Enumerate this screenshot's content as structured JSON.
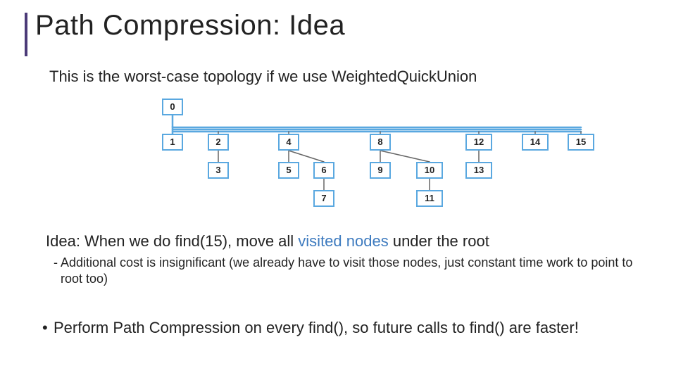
{
  "slide": {
    "title": "Path Compression: Idea",
    "subtitle": "This is the worst-case topology if we use WeightedQuickUnion",
    "idea_prefix": "Idea: When we do find(15), move all ",
    "idea_hl": "visited nodes",
    "idea_suffix": " under the root",
    "note": "- Additional cost is insignificant (we already have to visit those nodes, just constant time work to point to root too)",
    "bullet": "Perform Path Compression on every find(), so future calls to find() are faster!"
  },
  "tree": {
    "nodes": {
      "n0": "0",
      "n1": "1",
      "n2": "2",
      "n3": "3",
      "n4": "4",
      "n5": "5",
      "n6": "6",
      "n7": "7",
      "n8": "8",
      "n9": "9",
      "n10": "10",
      "n11": "11",
      "n12": "12",
      "n13": "13",
      "n14": "14",
      "n15": "15"
    },
    "edges": [
      [
        "n0",
        "n1"
      ],
      [
        "n0",
        "n2"
      ],
      [
        "n0",
        "n4"
      ],
      [
        "n0",
        "n8"
      ],
      [
        "n0",
        "n12"
      ],
      [
        "n0",
        "n14"
      ],
      [
        "n0",
        "n15"
      ],
      [
        "n2",
        "n3"
      ],
      [
        "n4",
        "n5"
      ],
      [
        "n4",
        "n6"
      ],
      [
        "n6",
        "n7"
      ],
      [
        "n8",
        "n9"
      ],
      [
        "n8",
        "n10"
      ],
      [
        "n10",
        "n11"
      ],
      [
        "n12",
        "n13"
      ]
    ]
  }
}
